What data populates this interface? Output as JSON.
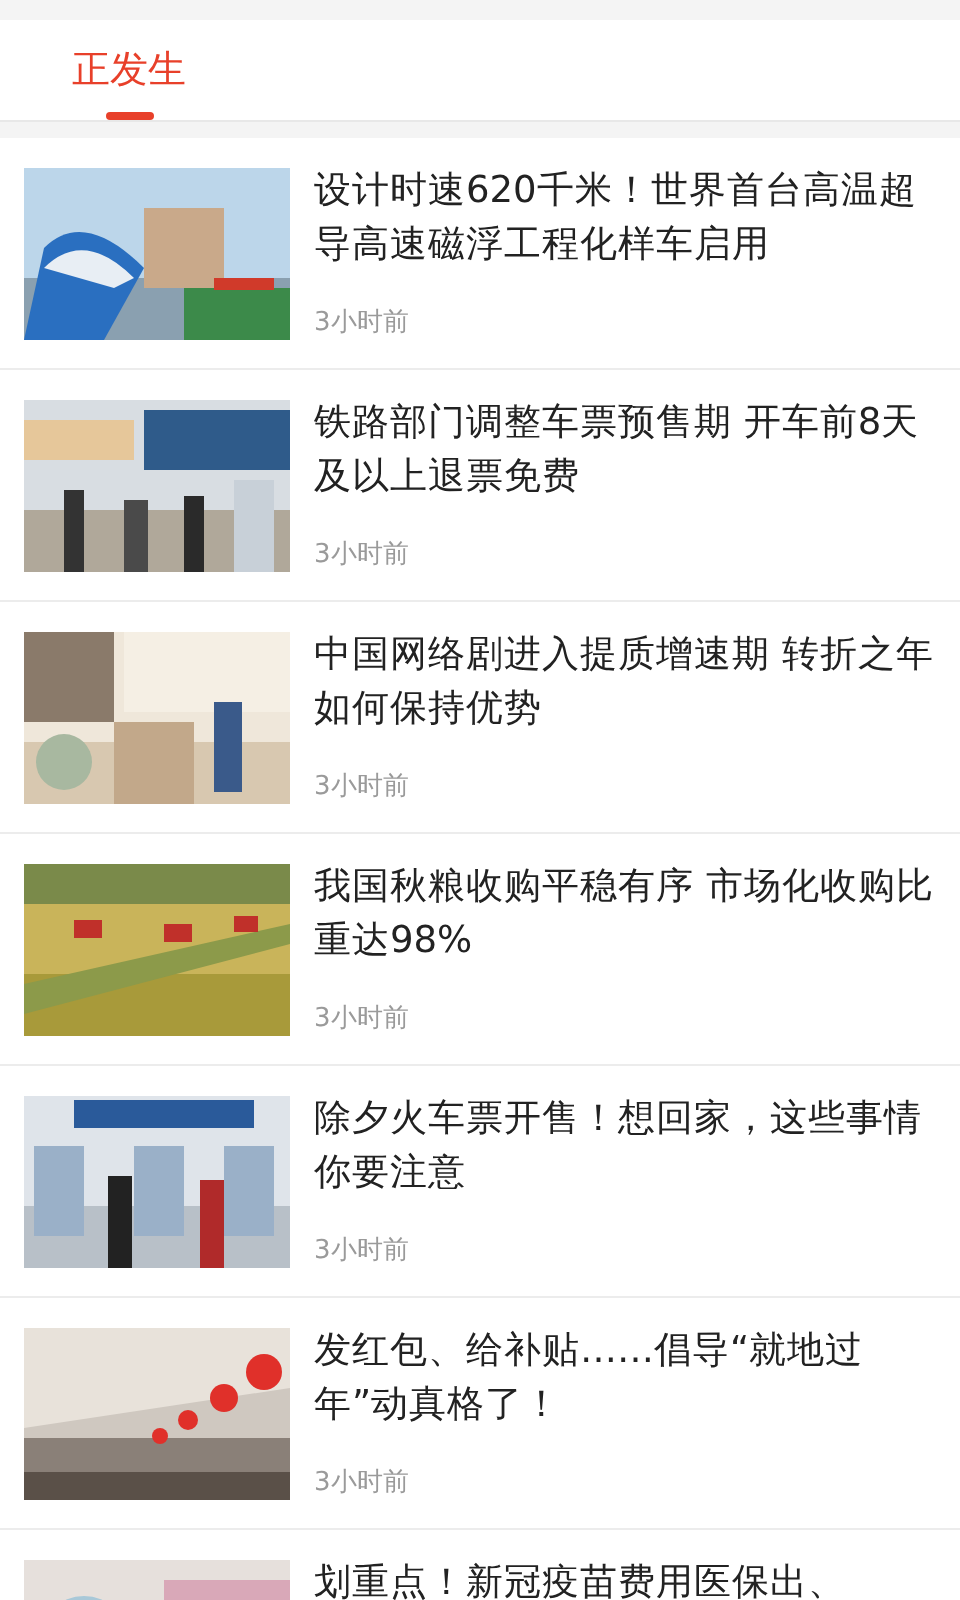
{
  "tabs": [
    {
      "label": "正发生",
      "selected": true
    }
  ],
  "articles": [
    {
      "title": "设计时速620千米！世界首台高温超导高速磁浮工程化样车启用",
      "time": "3小时前"
    },
    {
      "title": "铁路部门调整车票预售期 开车前8天及以上退票免费",
      "time": "3小时前"
    },
    {
      "title": "中国网络剧进入提质增速期 转折之年如何保持优势",
      "time": "3小时前"
    },
    {
      "title": "我国秋粮收购平稳有序 市场化收购比重达98%",
      "time": "3小时前"
    },
    {
      "title": "除夕火车票开售！想回家，这些事情你要注意",
      "time": "3小时前"
    },
    {
      "title": "发红包、给补贴……倡导“就地过年”动真格了！",
      "time": "3小时前"
    },
    {
      "title": "划重点！新冠疫苗费用医保出、"
    }
  ]
}
